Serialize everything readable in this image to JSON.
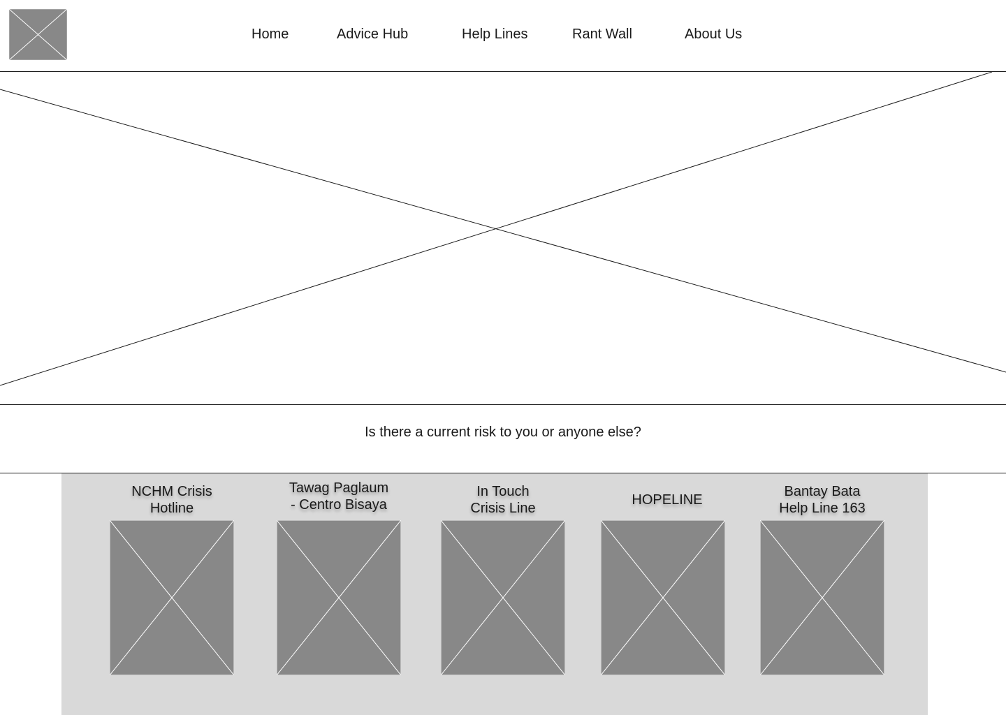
{
  "header": {
    "logo_icon": "image-placeholder-icon",
    "nav": [
      {
        "label": "Home"
      },
      {
        "label": "Advice Hub"
      },
      {
        "label": "Help Lines"
      },
      {
        "label": "Rant Wall"
      },
      {
        "label": "About Us"
      }
    ]
  },
  "hero": {
    "image_icon": "image-placeholder-icon"
  },
  "question": {
    "text": "Is there a current risk to you or anyone else?"
  },
  "hotlines": [
    {
      "title": "NCHM Crisis\nHotline",
      "image_icon": "image-placeholder-icon"
    },
    {
      "title": "Tawag Paglaum\n- Centro Bisaya",
      "image_icon": "image-placeholder-icon"
    },
    {
      "title": "In Touch\nCrisis Line",
      "image_icon": "image-placeholder-icon"
    },
    {
      "title": "HOPELINE",
      "image_icon": "image-placeholder-icon"
    },
    {
      "title": "Bantay Bata\nHelp Line 163",
      "image_icon": "image-placeholder-icon"
    }
  ],
  "colors": {
    "placeholder": "#888888",
    "panel_background": "#d9d9d9",
    "line": "#1a1a1a"
  }
}
